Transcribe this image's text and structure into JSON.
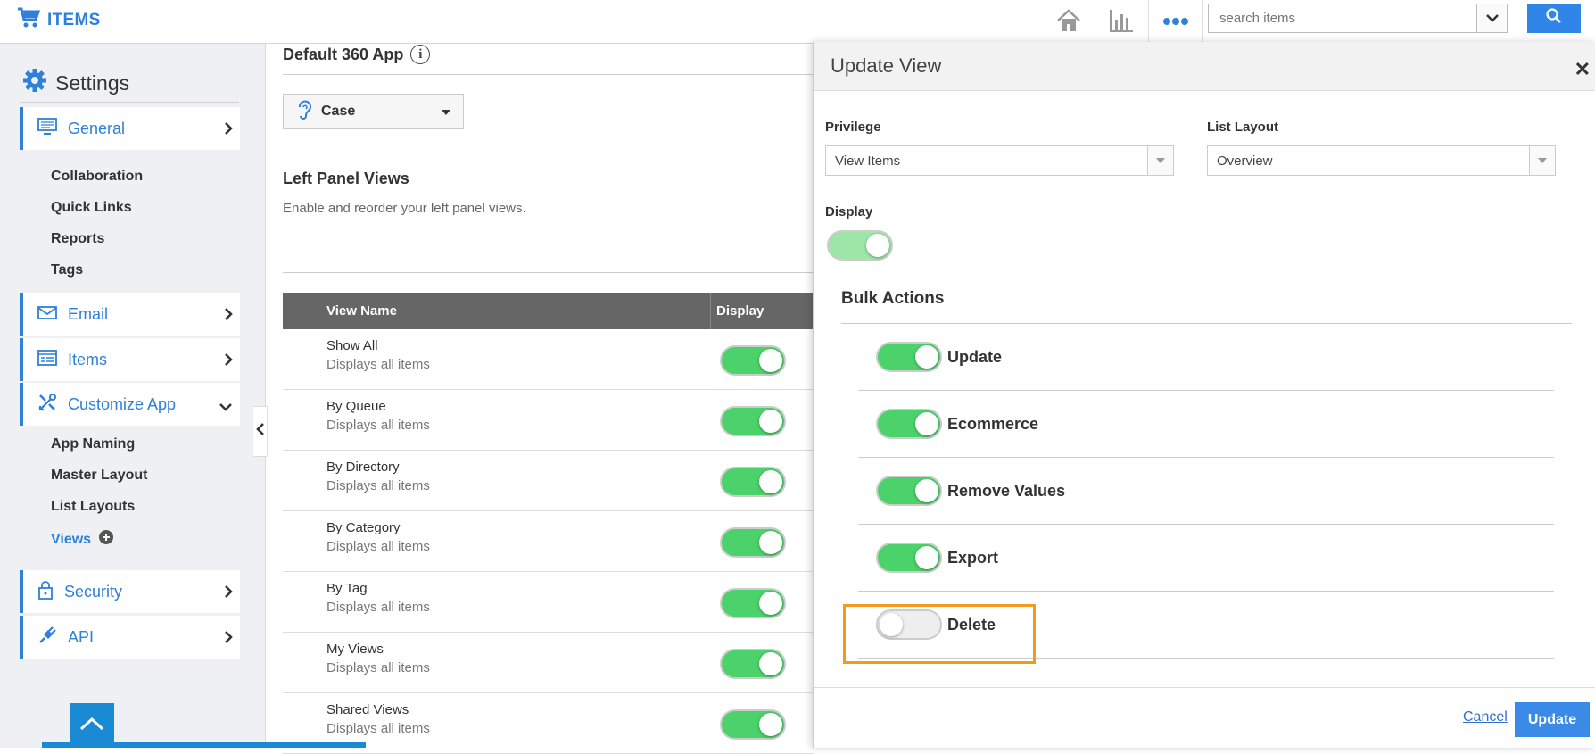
{
  "app": {
    "name": "ITEMS"
  },
  "search": {
    "placeholder": "search items"
  },
  "sidebar": {
    "title": "Settings",
    "sections": {
      "general": "General",
      "email": "Email",
      "items": "Items",
      "customize": "Customize App",
      "security": "Security",
      "api": "API"
    },
    "general_sub": [
      "Collaboration",
      "Quick Links",
      "Reports",
      "Tags"
    ],
    "customize_sub": [
      "App Naming",
      "Master Layout",
      "List Layouts",
      "Views"
    ]
  },
  "main": {
    "app_title": "Default 360 App",
    "module": "Case",
    "left_panel_title": "Left Panel Views",
    "left_panel_desc": "Enable and reorder your left panel views.",
    "table": {
      "headers": [
        "View Name",
        "Display"
      ],
      "rows": [
        {
          "name": "Show All",
          "desc": "Displays all items",
          "display": true
        },
        {
          "name": "By Queue",
          "desc": "Displays all items",
          "display": true
        },
        {
          "name": "By Directory",
          "desc": "Displays all items",
          "display": true
        },
        {
          "name": "By Category",
          "desc": "Displays all items",
          "display": true
        },
        {
          "name": "By Tag",
          "desc": "Displays all items",
          "display": true
        },
        {
          "name": "My Views",
          "desc": "Displays all items",
          "display": true
        },
        {
          "name": "Shared Views",
          "desc": "Displays all items",
          "display": true
        }
      ]
    }
  },
  "panel": {
    "title": "Update View",
    "privilege_label": "Privilege",
    "privilege_value": "View Items",
    "list_layout_label": "List Layout",
    "list_layout_value": "Overview",
    "display_label": "Display",
    "display_on": true,
    "bulk_title": "Bulk Actions",
    "bulk_actions": [
      {
        "label": "Update",
        "on": true
      },
      {
        "label": "Ecommerce",
        "on": true
      },
      {
        "label": "Remove Values",
        "on": true
      },
      {
        "label": "Export",
        "on": true
      },
      {
        "label": "Delete",
        "on": false
      }
    ],
    "cancel_label": "Cancel",
    "update_label": "Update"
  },
  "colors": {
    "accent": "#2f80d8",
    "toggle_on": "#4bd26a",
    "highlight": "#f39a1d",
    "header": "#666666"
  }
}
